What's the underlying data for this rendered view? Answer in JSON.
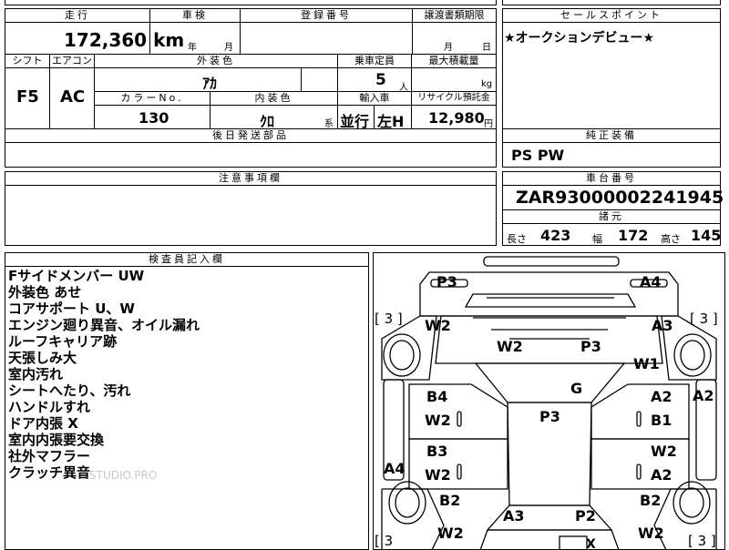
{
  "spec": {
    "mileage_label": "走行",
    "mileage_value": "172,360",
    "mileage_unit": "km",
    "inspection_label": "車検",
    "inspection_year_unit": "年",
    "inspection_month_unit": "月",
    "registration_label": "登録番号",
    "transfer_label": "譲渡書類期限",
    "transfer_month_unit": "月",
    "transfer_day_unit": "日",
    "shift_label": "シフト",
    "shift_value": "F5",
    "ac_label": "エアコン",
    "ac_value": "AC",
    "exterior_color_label": "外装色",
    "exterior_color_value": "ｱｶ",
    "capacity_label": "乗車定員",
    "capacity_value": "5",
    "capacity_unit": "人",
    "max_load_label": "最大積載量",
    "max_load_unit": "kg",
    "color_no_label": "カラーNo.",
    "color_no_value": "130",
    "interior_color_label": "内装色",
    "interior_color_value": "ｸﾛ",
    "interior_color_unit": "系",
    "import_label": "輸入車",
    "import_value_a": "並行",
    "import_value_b": "左H",
    "recycle_label": "リサイクル預託金",
    "recycle_value": "12,980",
    "recycle_unit": "円"
  },
  "sections": {
    "sales_point_label": "セールスポイント",
    "sales_point_text": "★オークションデビュー★",
    "later_parts_label": "後日発送部品",
    "genuine_equip_label": "純正装備",
    "genuine_equip_value": "PS PW",
    "caution_label": "注意事項欄",
    "chassis_label": "車台番号",
    "chassis_value": "ZAR93000002241945",
    "dimensions_label": "諸元",
    "length_label": "長さ",
    "length_value": "423",
    "width_label": "幅",
    "width_value": "172",
    "height_label": "高さ",
    "height_value": "145",
    "inspector_label": "検査員記入欄"
  },
  "inspector_notes": [
    "Fサイドメンバー UW",
    "外装色 あせ",
    "コアサポート U、W",
    "エンジン廻り異音、オイル漏れ",
    "ルーフキャリア跡",
    "天張しみ大",
    "室内汚れ",
    "シートへたり、汚れ",
    "ハンドルすれ",
    "ドア内張 X",
    "室内内張要交換",
    "社外マフラー",
    "クラッチ異音"
  ],
  "watermark": "STUDIO.PRO",
  "diagram_marks": {
    "p3_tl": "P3",
    "a4_tr": "A4",
    "tire_lf": "[ 3 ]",
    "tire_rf": "[ 3 ]",
    "w2_lf": "W2",
    "a3_rf": "A3",
    "w2_hood": "W2",
    "p3_hood": "P3",
    "w1_rf": "W1",
    "a2_rside": "A2",
    "g_center": "G",
    "b4_ldoor": "B4",
    "w2_ldoor": "W2",
    "a2_rdoor": "A2",
    "b1_rdoor": "B1",
    "p3_roof": "P3",
    "b3_lrdoor": "B3",
    "w2_lrdoor": "W2",
    "w2_rrdoor": "W2",
    "a2_rrdoor": "A2",
    "a4_lside": "A4",
    "b2_lr": "B2",
    "b2_rr": "B2",
    "a3_trunk": "A3",
    "p2_trunk": "P2",
    "w2_lrear": "W2",
    "w2_rrear": "W2",
    "tire_lr": "[ 3",
    "tire_rr": "[ 3 ]",
    "x_rear": "X"
  }
}
